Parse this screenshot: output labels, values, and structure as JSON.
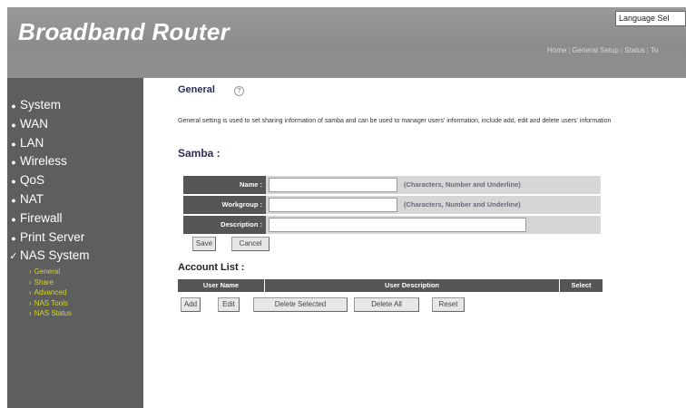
{
  "header": {
    "brand": "Broadband Router",
    "language_select": "Language Sel",
    "top_links": [
      "Home",
      "General Setup",
      "Status",
      "To"
    ]
  },
  "sidebar": {
    "items": [
      {
        "label": "System",
        "active": false
      },
      {
        "label": "WAN",
        "active": false
      },
      {
        "label": "LAN",
        "active": false
      },
      {
        "label": "Wireless",
        "active": false
      },
      {
        "label": "QoS",
        "active": false
      },
      {
        "label": "NAT",
        "active": false
      },
      {
        "label": "Firewall",
        "active": false
      },
      {
        "label": "Print Server",
        "active": false
      },
      {
        "label": "NAS System",
        "active": true
      }
    ],
    "subitems": [
      {
        "label": "General"
      },
      {
        "label": "Share"
      },
      {
        "label": "Advanced"
      },
      {
        "label": "NAS Tools"
      },
      {
        "label": "NAS Status"
      }
    ]
  },
  "main": {
    "title": "General",
    "description": "General setting is used to set sharing information of samba and can be used to manager users' information, include add, edit and delete users' information",
    "samba_heading": "Samba :",
    "fields": {
      "name": {
        "label": "Name :",
        "value": "",
        "hint": "(Characters, Number and Underline)"
      },
      "workgroup": {
        "label": "Workgroup :",
        "value": "",
        "hint": "(Characters, Number and Underline)"
      },
      "description": {
        "label": "Description :",
        "value": ""
      }
    },
    "save_label": "Save",
    "cancel_label": "Cancel",
    "account_heading": "Account List :",
    "table_headers": [
      "User Name",
      "User Description",
      "Select"
    ],
    "add_label": "Add",
    "edit_label": "Edit",
    "delete_selected_label": "Delete Selected",
    "delete_all_label": "Delete All",
    "reset_label": "Reset"
  },
  "colors": {
    "header_bg": "#8f8f8f",
    "sidebar_bg": "#5e5e5e",
    "sub_nav": "#d4d62a",
    "label_bg": "#555555",
    "field_bg": "#d6d6d6"
  }
}
